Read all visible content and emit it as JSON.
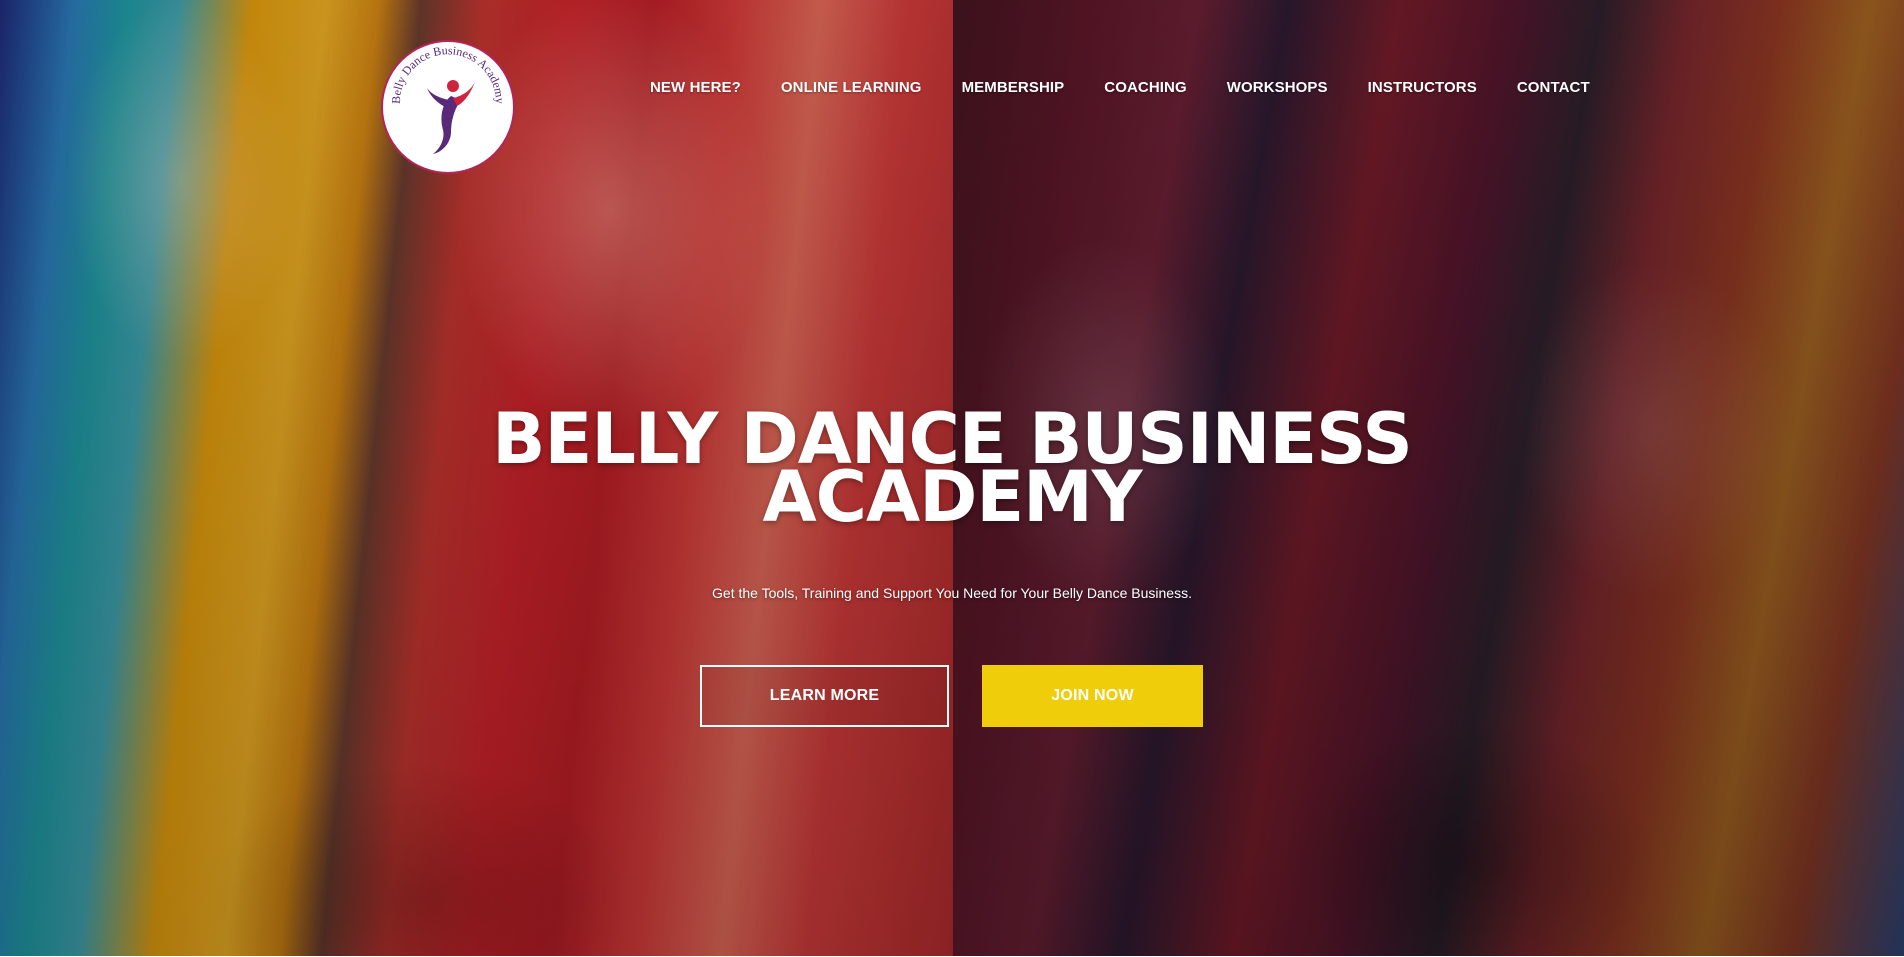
{
  "logo": {
    "text": "Belly Dance Business Academy",
    "colors": {
      "ring": "#b3245a",
      "figure_purple": "#5a2a7a",
      "figure_red": "#d0233c"
    }
  },
  "nav": {
    "items": [
      {
        "label": "NEW HERE?"
      },
      {
        "label": "ONLINE LEARNING"
      },
      {
        "label": "MEMBERSHIP"
      },
      {
        "label": "COACHING"
      },
      {
        "label": "WORKSHOPS"
      },
      {
        "label": "INSTRUCTORS"
      },
      {
        "label": "CONTACT"
      }
    ]
  },
  "hero": {
    "title_line1": "BELLY DANCE BUSINESS",
    "title_line2": "ACADEMY",
    "subtitle": "Get the Tools, Training and Support You Need for Your Belly Dance Business.",
    "buttons": {
      "learn_more": "LEARN MORE",
      "join_now": "JOIN NOW"
    }
  },
  "colors": {
    "join_button": "#f0cd0a",
    "text": "#ffffff"
  }
}
